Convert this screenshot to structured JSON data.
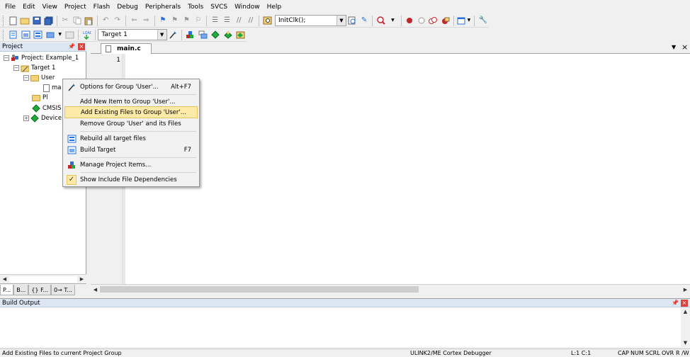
{
  "menu": [
    "File",
    "Edit",
    "View",
    "Project",
    "Flash",
    "Debug",
    "Peripherals",
    "Tools",
    "SVCS",
    "Window",
    "Help"
  ],
  "toolbar": {
    "find_combo_value": "InitClk();",
    "target_combo_value": "Target 1"
  },
  "project_panel": {
    "title": "Project",
    "pin_glyph": "⬤",
    "close_glyph": "×",
    "tree": {
      "project": "Project: Example_1",
      "target": "Target 1",
      "user": "User",
      "main_file": "ma",
      "pl": "Pl",
      "cmsis": "CMSIS",
      "device": "Device"
    },
    "tabs": [
      "P...",
      "B...",
      "{} F...",
      "0→ T..."
    ]
  },
  "editor": {
    "tab_label": "main.c",
    "line_numbers": [
      "1"
    ]
  },
  "build_output": {
    "title": "Build Output"
  },
  "status_bar": {
    "message": "Add Existing Files to current Project Group",
    "debugger": "ULINK2/ME Cortex Debugger",
    "position": "L:1 C:1",
    "caps": "CAP",
    "num": "NUM",
    "scrl": "SCRL",
    "ovr": "OVR",
    "rw": "R /W"
  },
  "context_menu": {
    "items": [
      {
        "label": "Options for Group 'User'...",
        "shortcut": "Alt+F7",
        "icon": "wand-icon"
      },
      {
        "label": "Add New  Item to Group 'User'...",
        "shortcut": "",
        "icon": ""
      },
      {
        "label": "Add Existing Files to Group 'User'...",
        "shortcut": "",
        "icon": "",
        "highlighted": true
      },
      {
        "label": "Remove Group 'User' and its Files",
        "shortcut": "",
        "icon": ""
      },
      {
        "label": "Rebuild all target files",
        "shortcut": "",
        "icon": "rebuild-icon"
      },
      {
        "label": "Build Target",
        "shortcut": "F7",
        "icon": "build-icon"
      },
      {
        "label": "Manage Project Items...",
        "shortcut": "",
        "icon": "components-icon"
      },
      {
        "label": "Show Include File Dependencies",
        "shortcut": "",
        "icon": "check-icon",
        "checked": true
      }
    ]
  },
  "colors": {
    "panel_header": "#dde6f3",
    "highlight": "#fde9a8",
    "close_red": "#d9443c"
  }
}
